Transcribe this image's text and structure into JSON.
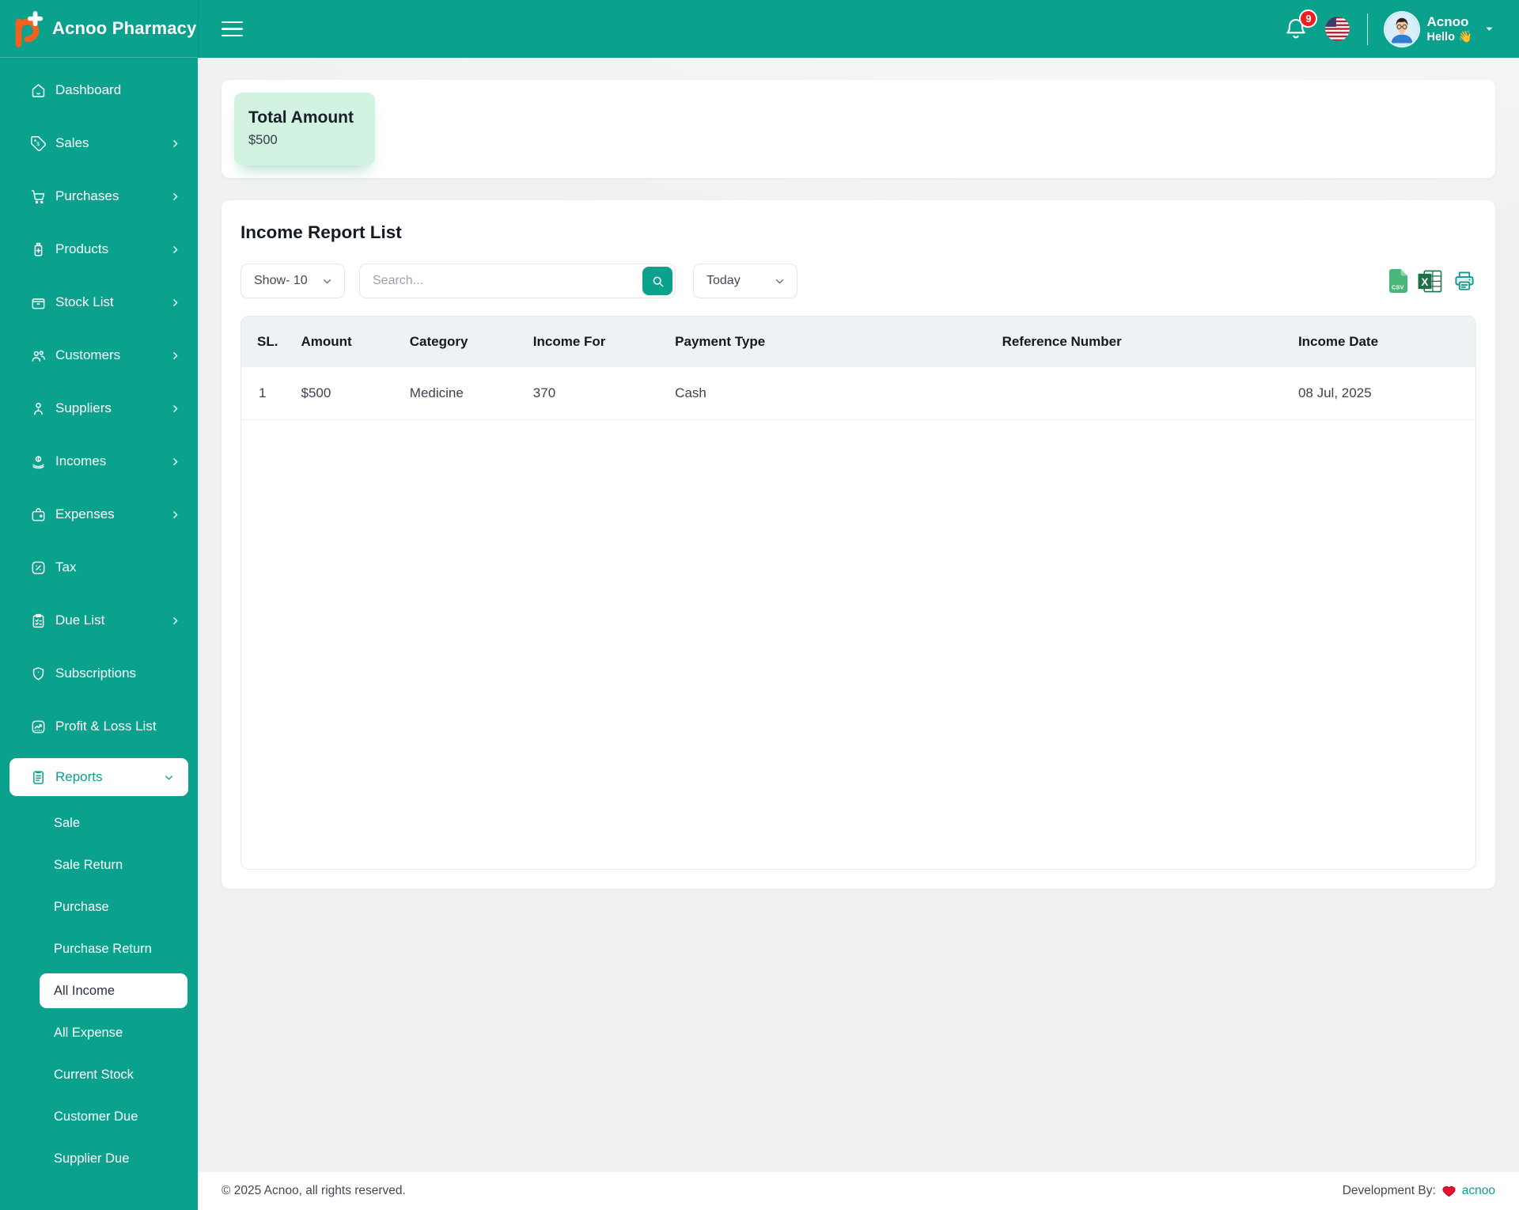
{
  "brand": {
    "name": "Acnoo Pharmacy",
    "logo_icon": "pharmacy-logo-icon"
  },
  "header": {
    "notification_count": "9",
    "user_name": "Acnoo",
    "greeting": "Hello",
    "wave_emoji": "👋",
    "icons": [
      "bell-icon",
      "usa-flag-icon",
      "avatar",
      "chevron-down-icon"
    ]
  },
  "sidebar": {
    "items": [
      {
        "label": "Dashboard",
        "icon": "home-icon"
      },
      {
        "label": "Sales",
        "icon": "tag-icon",
        "chevron": "right"
      },
      {
        "label": "Purchases",
        "icon": "cart-icon",
        "chevron": "right"
      },
      {
        "label": "Products",
        "icon": "bottle-icon",
        "chevron": "right"
      },
      {
        "label": "Stock List",
        "icon": "box-icon",
        "chevron": "right"
      },
      {
        "label": "Customers",
        "icon": "users-icon",
        "chevron": "right"
      },
      {
        "label": "Suppliers",
        "icon": "person-icon",
        "chevron": "right"
      },
      {
        "label": "Incomes",
        "icon": "coin-hand-icon",
        "chevron": "right"
      },
      {
        "label": "Expenses",
        "icon": "wallet-icon",
        "chevron": "right"
      },
      {
        "label": "Tax",
        "icon": "percent-icon"
      },
      {
        "label": "Due List",
        "icon": "clipboard-check-icon",
        "chevron": "right"
      },
      {
        "label": "Subscriptions",
        "icon": "shield-icon"
      },
      {
        "label": "Profit & Loss List",
        "icon": "chart-square-icon"
      },
      {
        "label": "Reports",
        "icon": "report-icon",
        "chevron": "down",
        "active": true,
        "expanded": true
      }
    ],
    "reports_submenu": [
      {
        "label": "Sale"
      },
      {
        "label": "Sale Return"
      },
      {
        "label": "Purchase"
      },
      {
        "label": "Purchase Return"
      },
      {
        "label": "All Income",
        "active": true
      },
      {
        "label": "All Expense"
      },
      {
        "label": "Current Stock"
      },
      {
        "label": "Customer Due"
      },
      {
        "label": "Supplier Due"
      }
    ]
  },
  "summary": {
    "title": "Total Amount",
    "value": "$500"
  },
  "report": {
    "title": "Income Report List",
    "show_label": "Show- 10",
    "search_placeholder": "Search...",
    "search_icon": "search-icon",
    "date_filter": "Today",
    "export_icons": [
      "csv-file-icon",
      "excel-file-icon",
      "printer-icon"
    ]
  },
  "table": {
    "headers": [
      "SL.",
      "Amount",
      "Category",
      "Income For",
      "Payment Type",
      "Reference Number",
      "Income Date"
    ],
    "rows": [
      [
        "1",
        "$500",
        "Medicine",
        "370",
        "Cash",
        "",
        "08 Jul, 2025"
      ]
    ]
  },
  "footer": {
    "copyright": "© 2025 Acnoo, all rights reserved.",
    "dev_label": "Development By:",
    "dev_heart_icon": "heart-icon",
    "dev_link": "acnoo"
  },
  "colors": {
    "accent": "#0aa18d",
    "summary_card_bg": "#d2f3e1",
    "notification_badge": "#f01e1e",
    "csv_green": "#4ab77a",
    "excel_green": "#1e7145",
    "heart_red": "#e8112d"
  }
}
